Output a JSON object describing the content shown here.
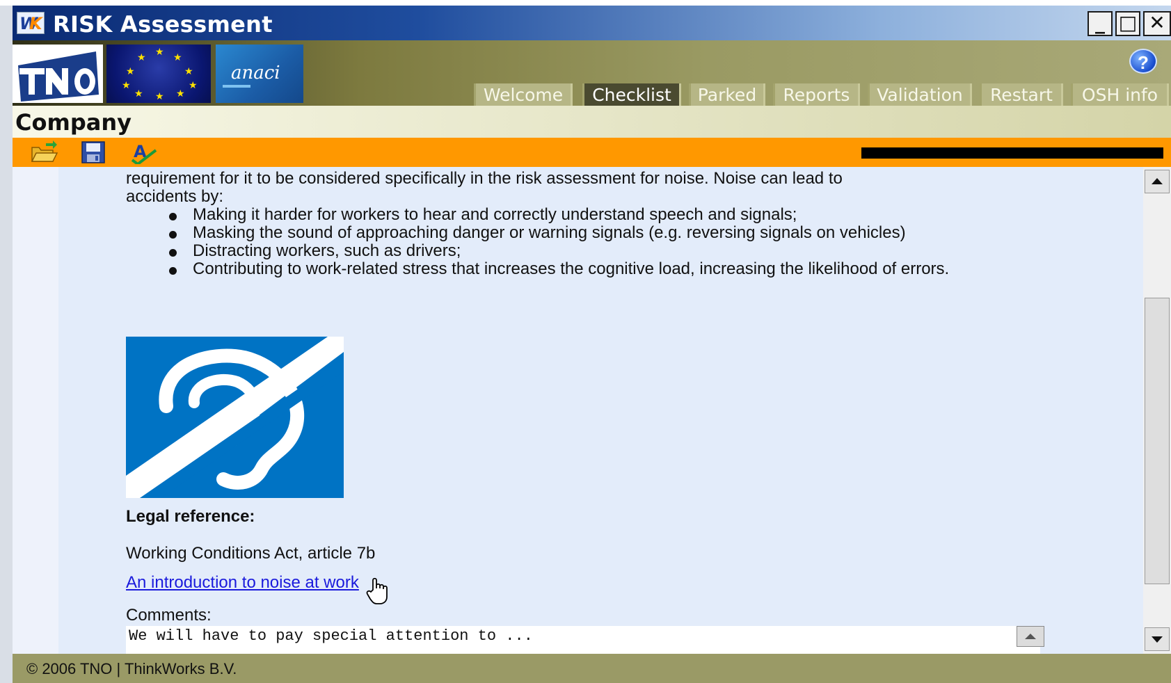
{
  "window": {
    "title": "RISK Assessment",
    "minimize_label": "_",
    "maximize_label": "□",
    "close_label": "✕"
  },
  "header": {
    "logos": [
      "TNO",
      "EU",
      "anaci"
    ],
    "anaci_text": "anaci",
    "help_label": "?",
    "tabs": [
      {
        "label": "Welcome",
        "active": false
      },
      {
        "label": "Checklist",
        "active": true
      },
      {
        "label": "Parked",
        "active": false
      },
      {
        "label": "Reports",
        "active": false
      },
      {
        "label": "Validation",
        "active": false
      },
      {
        "label": "Restart",
        "active": false
      },
      {
        "label": "OSH info",
        "active": false
      }
    ]
  },
  "company_bar": {
    "label": "Company"
  },
  "toolbar": {
    "icons": [
      "open-folder-icon",
      "save-icon",
      "spellcheck-icon"
    ],
    "accent_color": "#ff9800"
  },
  "content": {
    "intro_line_1": "requirement for it to be considered specifically in the risk assessment for noise. Noise can lead to",
    "intro_line_2": "accidents by:",
    "bullets": [
      "Making it harder for workers to hear and correctly understand speech and signals;",
      "Masking the sound of approaching danger or warning signals (e.g. reversing signals on vehicles)",
      "Distracting workers, such as drivers;",
      "Contributing to work-related stress that increases the cognitive load, increasing the likelihood of errors."
    ],
    "legal_heading": "Legal reference:",
    "legal_reference": "Working Conditions Act, article 7b",
    "link_text": "An introduction to noise at work",
    "comments_label": "Comments:",
    "comments_value": "We will have to pay special attention to ..."
  },
  "footer": {
    "copyright": "© 2006 TNO | ThinkWorks B.V."
  }
}
